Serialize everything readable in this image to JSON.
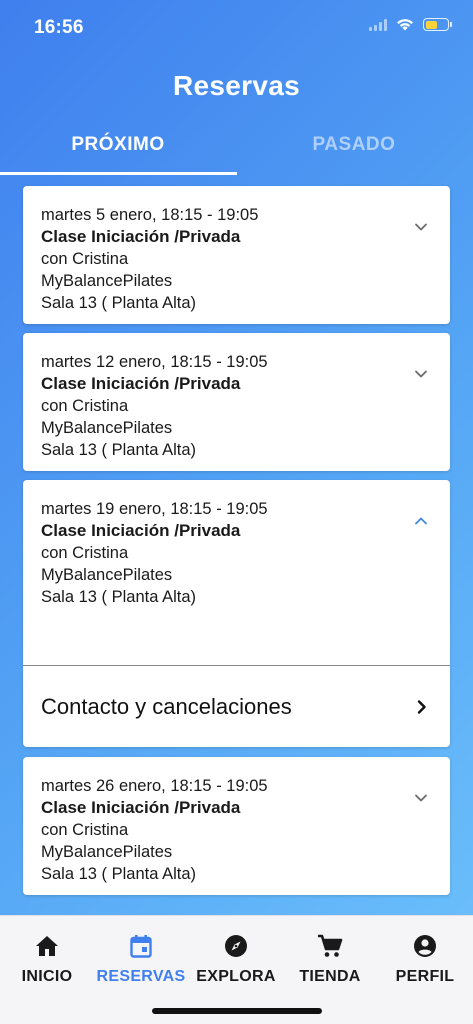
{
  "status_bar": {
    "time": "16:56"
  },
  "header": {
    "title": "Reservas"
  },
  "tabs": [
    {
      "label": "PRÓXIMO",
      "active": true
    },
    {
      "label": "PASADO",
      "active": false
    }
  ],
  "bookings": [
    {
      "date": "martes 5 enero, 18:15 - 19:05",
      "class": "Clase Iniciación /Privada",
      "instructor": "con Cristina",
      "studio": "MyBalancePilates",
      "room": "Sala 13 ( Planta Alta)",
      "expanded": false
    },
    {
      "date": "martes 12 enero, 18:15 - 19:05",
      "class": "Clase Iniciación /Privada",
      "instructor": "con Cristina",
      "studio": "MyBalancePilates",
      "room": "Sala 13 ( Planta Alta)",
      "expanded": false
    },
    {
      "date": "martes 19 enero, 18:15 - 19:05",
      "class": "Clase Iniciación /Privada",
      "instructor": "con Cristina",
      "studio": "MyBalancePilates",
      "room": "Sala 13 ( Planta Alta)",
      "expanded": true,
      "action": "Contacto y cancelaciones"
    },
    {
      "date": "martes 26 enero, 18:15 - 19:05",
      "class": "Clase Iniciación /Privada",
      "instructor": "con Cristina",
      "studio": "MyBalancePilates",
      "room": "Sala 13 ( Planta Alta)",
      "expanded": false
    }
  ],
  "bottom_nav": [
    {
      "label": "INICIO",
      "icon": "home-icon",
      "active": false
    },
    {
      "label": "RESERVAS",
      "icon": "calendar-icon",
      "active": true
    },
    {
      "label": "EXPLORA",
      "icon": "compass-icon",
      "active": false
    },
    {
      "label": "TIENDA",
      "icon": "cart-icon",
      "active": false
    },
    {
      "label": "PERFIL",
      "icon": "account-icon",
      "active": false
    }
  ],
  "colors": {
    "accent": "#3f7fee",
    "chevron_active": "#3f8ae0",
    "chevron_inactive": "#6b6b6b"
  }
}
